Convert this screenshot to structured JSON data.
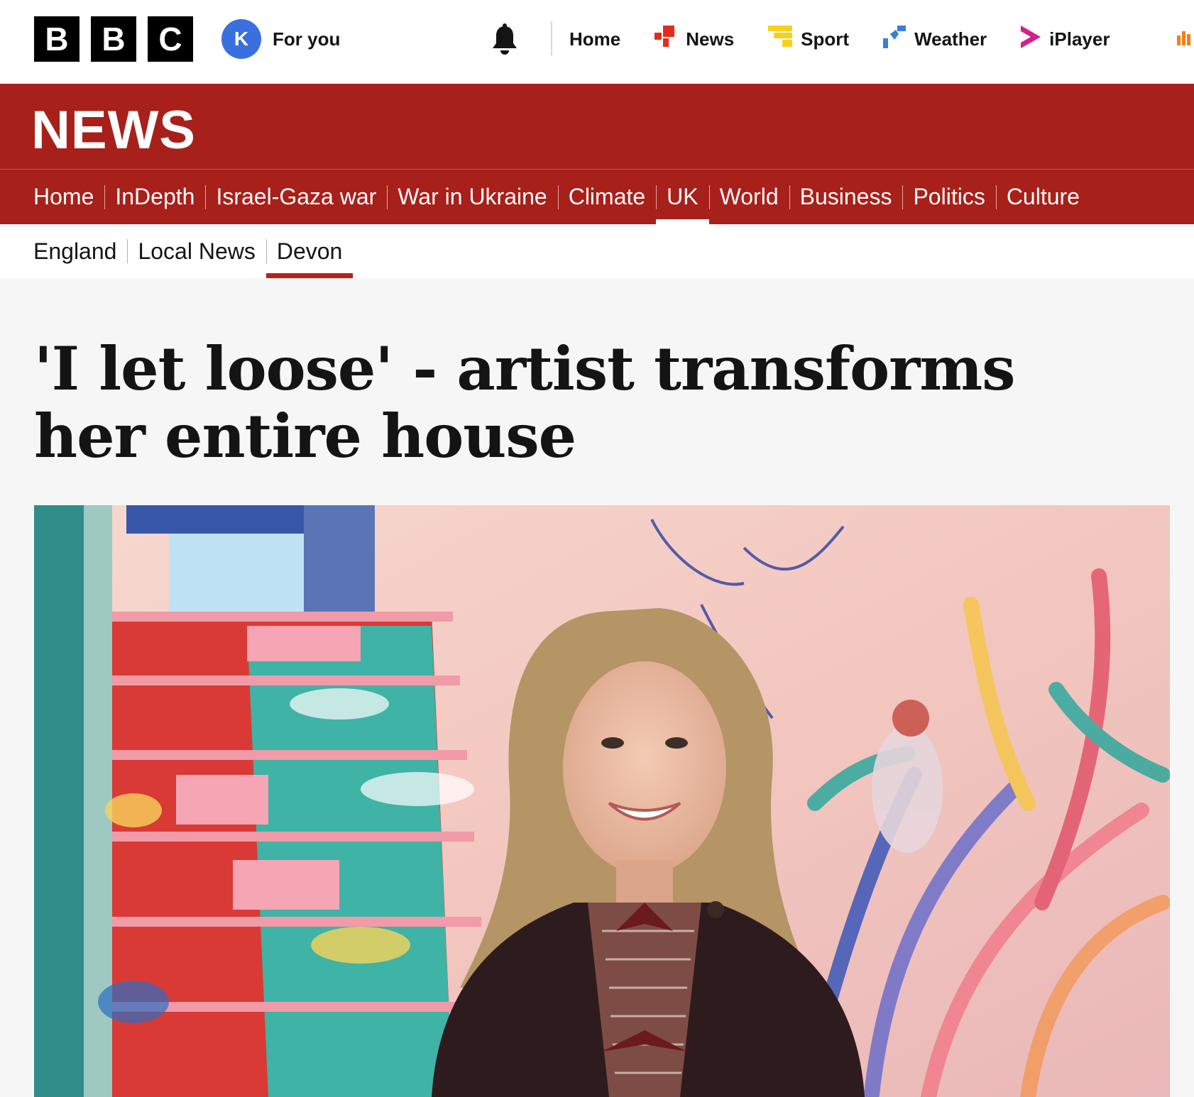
{
  "masthead": {
    "logo_letters": [
      "B",
      "B",
      "C"
    ],
    "avatar_initial": "K",
    "foryou_label": "For you",
    "bell_icon": "notification-bell-icon",
    "nav": [
      {
        "label": "Home",
        "icon": "none"
      },
      {
        "label": "News",
        "icon": "news-icon",
        "color": "#e32c1b"
      },
      {
        "label": "Sport",
        "icon": "sport-icon",
        "color": "#fad01d"
      },
      {
        "label": "Weather",
        "icon": "weather-icon",
        "color": "#3a7fd6"
      },
      {
        "label": "iPlayer",
        "icon": "iplayer-icon",
        "color": "#d41f8c"
      }
    ]
  },
  "banner": {
    "wordmark": "NEWS",
    "color": "#a8201a"
  },
  "section_nav": {
    "items": [
      "Home",
      "InDepth",
      "Israel-Gaza war",
      "War in Ukraine",
      "Climate",
      "UK",
      "World",
      "Business",
      "Politics",
      "Culture"
    ],
    "active": "UK"
  },
  "sub_nav": {
    "items": [
      "England",
      "Local News",
      "Devon"
    ],
    "active": "Devon"
  },
  "article": {
    "headline": "'I let loose' - artist transforms her entire house",
    "hero_image": "woman-smiling-in-front-of-painted-staircase-and-mural"
  }
}
